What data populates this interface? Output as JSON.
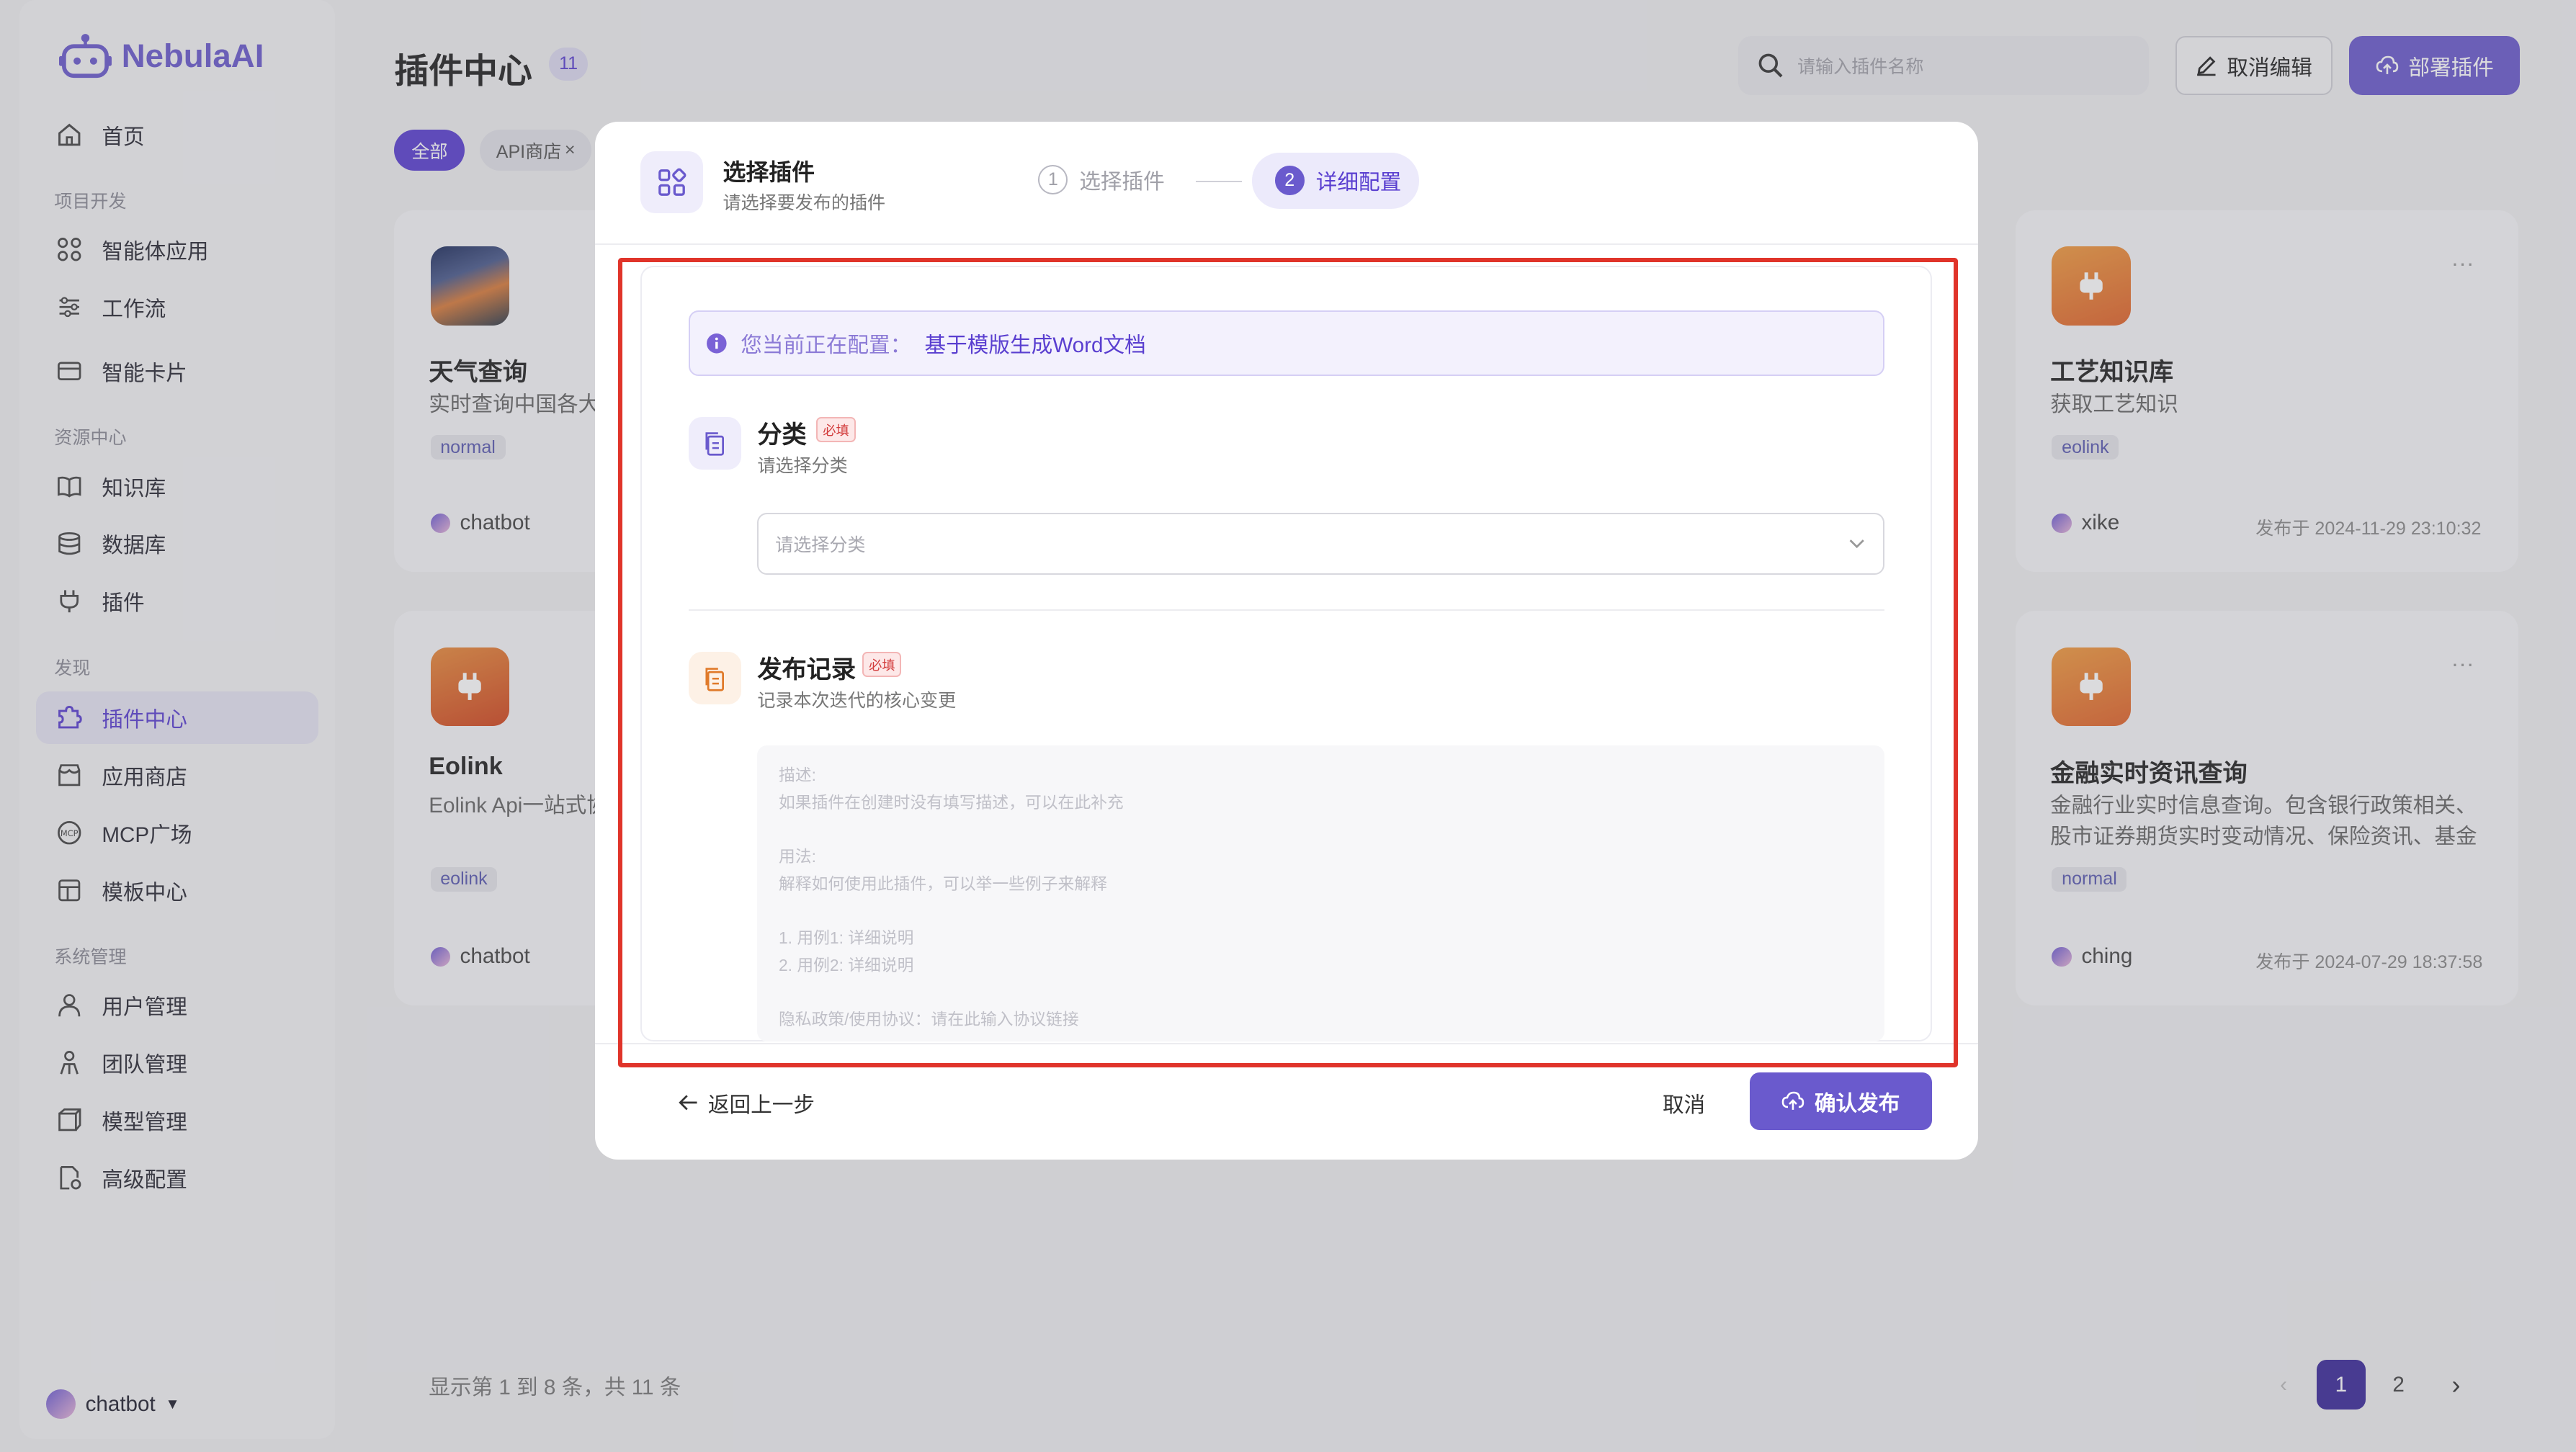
{
  "app": {
    "name": "NebulaAI"
  },
  "colors": {
    "accent": "#6a5acd",
    "highlight_box": "#e0342a",
    "required": "#d23c3c"
  },
  "sidebar": {
    "home": "首页",
    "section_project": "项目开发",
    "agents": "智能体应用",
    "workflow": "工作流",
    "cards": "智能卡片",
    "section_resources": "资源中心",
    "knowledge": "知识库",
    "database": "数据库",
    "plugin": "插件",
    "section_discover": "发现",
    "plugin_center": "插件中心",
    "app_store": "应用商店",
    "mcp": "MCP广场",
    "templates": "模板中心",
    "section_system": "系统管理",
    "users": "用户管理",
    "teams": "团队管理",
    "models": "模型管理",
    "advanced": "高级配置",
    "user_name": "chatbot"
  },
  "header": {
    "title": "插件中心",
    "count": "11",
    "search_placeholder": "请输入插件名称",
    "cancel_edit": "取消编辑",
    "deploy": "部署插件"
  },
  "filters": {
    "all": "全部",
    "api_store": "API商店"
  },
  "cards": [
    {
      "title": "天气查询",
      "desc": "实时查询中国各大城",
      "tag": "normal",
      "author": "chatbot"
    },
    {
      "title": "Eolink",
      "desc": "Eolink Api一站式协",
      "tag": "eolink",
      "author": "chatbot"
    },
    {
      "title": "工艺知识库",
      "desc": "获取工艺知识",
      "tag": "eolink",
      "author": "xike",
      "time": "发布于 2024-11-29 23:10:32"
    },
    {
      "title": "金融实时资讯查询",
      "desc": "金融行业实时信息查询。包含银行政策相关、股市证券期货实时变动情况、保险资讯、基金信...",
      "tag": "normal",
      "author": "ching",
      "time": "发布于 2024-07-29 18:37:58"
    }
  ],
  "pagination": {
    "info": "显示第 1 到 8 条，共 11 条",
    "page1": "1",
    "page2": "2"
  },
  "modal": {
    "title": "选择插件",
    "subtitle": "请选择要发布的插件",
    "step1": {
      "num": "1",
      "label": "选择插件"
    },
    "step2": {
      "num": "2",
      "label": "详细配置"
    },
    "info_prefix": "您当前正在配置：",
    "info_target": "基于模版生成Word文档",
    "category": {
      "title": "分类",
      "required": "必填",
      "sub": "请选择分类",
      "placeholder": "请选择分类"
    },
    "release": {
      "title": "发布记录",
      "required": "必填",
      "sub": "记录本次迭代的核心变更",
      "placeholder": "描述:\n如果插件在创建时没有填写描述，可以在此补充\n\n用法:\n解释如何使用此插件，可以举一些例子来解释\n\n1. 用例1: 详细说明\n2. 用例2: 详细说明\n\n隐私政策/使用协议：请在此输入协议链接"
    },
    "back": "返回上一步",
    "cancel": "取消",
    "confirm": "确认发布"
  }
}
